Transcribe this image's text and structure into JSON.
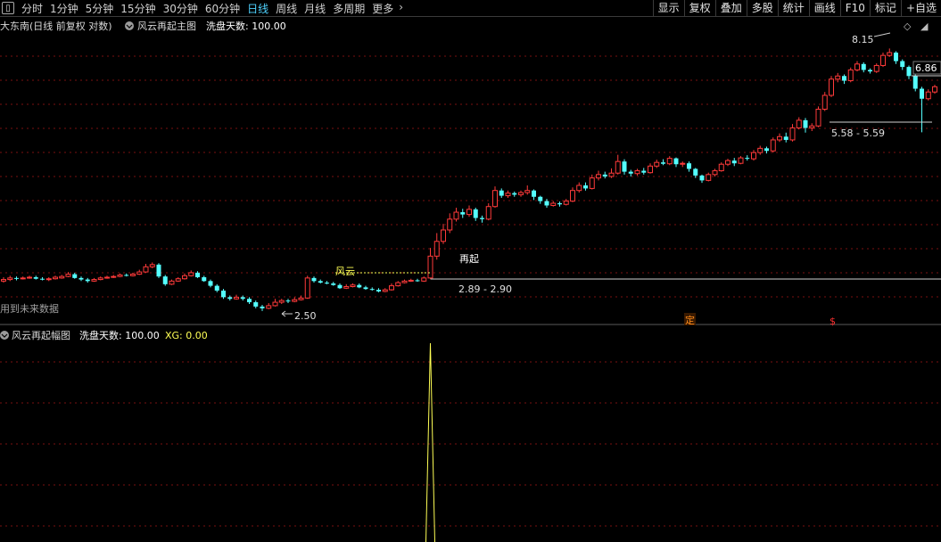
{
  "toolbar": {
    "periods": [
      "分时",
      "1分钟",
      "5分钟",
      "15分钟",
      "30分钟",
      "60分钟",
      "日线",
      "周线",
      "月线",
      "多周期",
      "更多"
    ],
    "active_period": "日线",
    "tools": [
      "显示",
      "复权",
      "叠加",
      "多股",
      "统计",
      "画线",
      "F10",
      "标记",
      "+自选"
    ]
  },
  "main_chart": {
    "stock_label": "大东南(日线 前复权 对数)",
    "indicator_name": "风云再起主图",
    "param_label": "洗盘天数: 100.00",
    "feng_yun_label": "风云",
    "zai_qi_label": "再起",
    "range_label_1": "2.89 - 2.90",
    "range_label_2": "5.58 - 5.59",
    "high_label": "8.15",
    "low_label": "2.50",
    "last_price_label": "6.86",
    "future_data_label": "用到未来数据",
    "marker_ding": "定",
    "marker_dollar": "$"
  },
  "sub_chart": {
    "indicator_name": "风云再起幅图",
    "param_label": "洗盘天数: 100.00",
    "xg_label": "XG: 0.00"
  },
  "colors": {
    "up": "#ff3a3a",
    "down": "#54ffff",
    "grid": "#7a1010",
    "signal": "#ffff55",
    "active": "#4fd3ff"
  },
  "chart_data": {
    "type": "candlestick",
    "price_range": [
      2.5,
      8.15
    ],
    "candles": [
      [
        2.86,
        2.88,
        2.91,
        2.84
      ],
      [
        2.88,
        2.9,
        2.93,
        2.86
      ],
      [
        2.9,
        2.89,
        2.92,
        2.87
      ],
      [
        2.89,
        2.9,
        2.92,
        2.88
      ],
      [
        2.9,
        2.91,
        2.93,
        2.89
      ],
      [
        2.91,
        2.89,
        2.93,
        2.88
      ],
      [
        2.89,
        2.88,
        2.91,
        2.87
      ],
      [
        2.88,
        2.89,
        2.91,
        2.86
      ],
      [
        2.89,
        2.91,
        2.93,
        2.88
      ],
      [
        2.9,
        2.92,
        2.94,
        2.89
      ],
      [
        2.92,
        2.95,
        2.98,
        2.91
      ],
      [
        2.95,
        2.9,
        2.97,
        2.89
      ],
      [
        2.9,
        2.88,
        2.92,
        2.86
      ],
      [
        2.88,
        2.86,
        2.9,
        2.84
      ],
      [
        2.86,
        2.88,
        2.9,
        2.85
      ],
      [
        2.88,
        2.9,
        2.92,
        2.87
      ],
      [
        2.9,
        2.91,
        2.93,
        2.89
      ],
      [
        2.91,
        2.92,
        2.94,
        2.9
      ],
      [
        2.92,
        2.94,
        2.96,
        2.91
      ],
      [
        2.94,
        2.93,
        2.96,
        2.92
      ],
      [
        2.93,
        2.95,
        2.97,
        2.92
      ],
      [
        2.95,
        2.98,
        3.01,
        2.94
      ],
      [
        2.98,
        3.05,
        3.09,
        2.97
      ],
      [
        3.05,
        3.08,
        3.11,
        3.03
      ],
      [
        3.08,
        2.92,
        3.1,
        2.9
      ],
      [
        2.92,
        2.82,
        2.94,
        2.8
      ],
      [
        2.82,
        2.86,
        2.88,
        2.81
      ],
      [
        2.86,
        2.89,
        2.91,
        2.85
      ],
      [
        2.89,
        2.93,
        2.96,
        2.88
      ],
      [
        2.93,
        2.97,
        3.0,
        2.92
      ],
      [
        2.97,
        2.91,
        2.99,
        2.9
      ],
      [
        2.91,
        2.86,
        2.93,
        2.85
      ],
      [
        2.86,
        2.8,
        2.88,
        2.78
      ],
      [
        2.8,
        2.74,
        2.82,
        2.72
      ],
      [
        2.74,
        2.66,
        2.76,
        2.64
      ],
      [
        2.66,
        2.64,
        2.68,
        2.62
      ],
      [
        2.64,
        2.66,
        2.69,
        2.63
      ],
      [
        2.66,
        2.64,
        2.68,
        2.62
      ],
      [
        2.64,
        2.6,
        2.66,
        2.58
      ],
      [
        2.6,
        2.55,
        2.62,
        2.53
      ],
      [
        2.55,
        2.53,
        2.57,
        2.5
      ],
      [
        2.53,
        2.56,
        2.59,
        2.52
      ],
      [
        2.56,
        2.6,
        2.64,
        2.55
      ],
      [
        2.6,
        2.62,
        2.64,
        2.58
      ],
      [
        2.62,
        2.61,
        2.64,
        2.59
      ],
      [
        2.61,
        2.63,
        2.66,
        2.6
      ],
      [
        2.63,
        2.65,
        2.68,
        2.62
      ],
      [
        2.65,
        2.9,
        2.93,
        2.64
      ],
      [
        2.9,
        2.86,
        2.92,
        2.84
      ],
      [
        2.86,
        2.84,
        2.88,
        2.83
      ],
      [
        2.84,
        2.83,
        2.86,
        2.82
      ],
      [
        2.83,
        2.81,
        2.85,
        2.8
      ],
      [
        2.81,
        2.77,
        2.83,
        2.76
      ],
      [
        2.77,
        2.79,
        2.82,
        2.76
      ],
      [
        2.79,
        2.81,
        2.83,
        2.78
      ],
      [
        2.81,
        2.78,
        2.83,
        2.77
      ],
      [
        2.78,
        2.76,
        2.8,
        2.75
      ],
      [
        2.76,
        2.75,
        2.78,
        2.74
      ],
      [
        2.75,
        2.73,
        2.77,
        2.72
      ],
      [
        2.73,
        2.75,
        2.77,
        2.72
      ],
      [
        2.75,
        2.8,
        2.83,
        2.74
      ],
      [
        2.8,
        2.84,
        2.86,
        2.79
      ],
      [
        2.84,
        2.86,
        2.88,
        2.83
      ],
      [
        2.86,
        2.87,
        2.89,
        2.85
      ],
      [
        2.87,
        2.86,
        2.89,
        2.85
      ],
      [
        2.86,
        2.9,
        2.92,
        2.85
      ],
      [
        2.9,
        3.2,
        3.32,
        2.89
      ],
      [
        3.2,
        3.42,
        3.55,
        3.15
      ],
      [
        3.42,
        3.6,
        3.7,
        3.38
      ],
      [
        3.6,
        3.78,
        3.88,
        3.55
      ],
      [
        3.78,
        3.9,
        3.98,
        3.74
      ],
      [
        3.9,
        3.86,
        3.96,
        3.8
      ],
      [
        3.86,
        3.95,
        4.02,
        3.82
      ],
      [
        3.95,
        3.8,
        3.98,
        3.75
      ],
      [
        3.8,
        3.78,
        3.84,
        3.72
      ],
      [
        3.78,
        4.0,
        4.06,
        3.76
      ],
      [
        4.0,
        4.3,
        4.38,
        3.98
      ],
      [
        4.3,
        4.2,
        4.34,
        4.16
      ],
      [
        4.2,
        4.25,
        4.3,
        4.16
      ],
      [
        4.25,
        4.22,
        4.28,
        4.18
      ],
      [
        4.22,
        4.26,
        4.3,
        4.18
      ],
      [
        4.26,
        4.3,
        4.4,
        4.22
      ],
      [
        4.3,
        4.18,
        4.32,
        4.12
      ],
      [
        4.18,
        4.1,
        4.2,
        4.05
      ],
      [
        4.1,
        4.02,
        4.14,
        3.98
      ],
      [
        4.02,
        4.06,
        4.1,
        4.0
      ],
      [
        4.06,
        4.04,
        4.09,
        4.0
      ],
      [
        4.04,
        4.1,
        4.14,
        4.02
      ],
      [
        4.1,
        4.3,
        4.36,
        4.08
      ],
      [
        4.3,
        4.4,
        4.46,
        4.26
      ],
      [
        4.4,
        4.34,
        4.46,
        4.3
      ],
      [
        4.34,
        4.55,
        4.62,
        4.32
      ],
      [
        4.55,
        4.62,
        4.7,
        4.5
      ],
      [
        4.62,
        4.58,
        4.68,
        4.54
      ],
      [
        4.58,
        4.65,
        4.75,
        4.55
      ],
      [
        4.65,
        4.9,
        5.05,
        4.62
      ],
      [
        4.9,
        4.68,
        4.95,
        4.62
      ],
      [
        4.68,
        4.64,
        4.72,
        4.58
      ],
      [
        4.64,
        4.7,
        4.74,
        4.6
      ],
      [
        4.7,
        4.66,
        4.76,
        4.62
      ],
      [
        4.66,
        4.8,
        4.86,
        4.64
      ],
      [
        4.8,
        4.88,
        4.94,
        4.76
      ],
      [
        4.88,
        4.85,
        4.95,
        4.82
      ],
      [
        4.85,
        4.97,
        5.02,
        4.82
      ],
      [
        4.97,
        4.84,
        4.99,
        4.78
      ],
      [
        4.84,
        4.86,
        4.9,
        4.78
      ],
      [
        4.86,
        4.74,
        4.9,
        4.68
      ],
      [
        4.74,
        4.6,
        4.76,
        4.55
      ],
      [
        4.6,
        4.5,
        4.62,
        4.45
      ],
      [
        4.5,
        4.62,
        4.66,
        4.48
      ],
      [
        4.62,
        4.7,
        4.74,
        4.58
      ],
      [
        4.7,
        4.84,
        4.88,
        4.68
      ],
      [
        4.84,
        4.92,
        4.96,
        4.8
      ],
      [
        4.92,
        4.86,
        4.98,
        4.8
      ],
      [
        4.86,
        4.98,
        5.02,
        4.84
      ],
      [
        4.98,
        4.96,
        5.04,
        4.92
      ],
      [
        4.96,
        5.1,
        5.16,
        4.92
      ],
      [
        5.1,
        5.2,
        5.26,
        5.05
      ],
      [
        5.2,
        5.14,
        5.24,
        5.08
      ],
      [
        5.14,
        5.4,
        5.46,
        5.1
      ],
      [
        5.4,
        5.48,
        5.56,
        5.35
      ],
      [
        5.48,
        5.4,
        5.58,
        5.34
      ],
      [
        5.4,
        5.7,
        5.8,
        5.36
      ],
      [
        5.7,
        5.9,
        5.98,
        5.66
      ],
      [
        5.9,
        5.7,
        5.96,
        5.58
      ],
      [
        5.7,
        5.75,
        5.82,
        5.62
      ],
      [
        5.75,
        6.2,
        6.28,
        5.72
      ],
      [
        6.2,
        6.6,
        6.7,
        6.15
      ],
      [
        6.6,
        7.1,
        7.2,
        6.55
      ],
      [
        7.1,
        7.2,
        7.3,
        7.0
      ],
      [
        7.2,
        7.05,
        7.25,
        6.95
      ],
      [
        7.05,
        7.4,
        7.48,
        7.0
      ],
      [
        7.4,
        7.6,
        7.7,
        7.35
      ],
      [
        7.6,
        7.4,
        7.66,
        7.32
      ],
      [
        7.4,
        7.35,
        7.45,
        7.28
      ],
      [
        7.35,
        7.55,
        7.62,
        7.3
      ],
      [
        7.55,
        7.9,
        8.0,
        7.5
      ],
      [
        7.9,
        8.0,
        8.15,
        7.85
      ],
      [
        8.0,
        7.7,
        8.05,
        7.6
      ],
      [
        7.7,
        7.5,
        7.76,
        7.4
      ],
      [
        7.5,
        7.2,
        7.55,
        7.1
      ],
      [
        7.2,
        6.8,
        7.25,
        6.72
      ],
      [
        6.8,
        6.5,
        6.86,
        5.59
      ],
      [
        6.5,
        6.7,
        6.78,
        6.45
      ],
      [
        6.7,
        6.86,
        6.92,
        6.65
      ]
    ],
    "signal_index": 66,
    "xg_value": 0.0,
    "xg_peak": 100.0
  }
}
